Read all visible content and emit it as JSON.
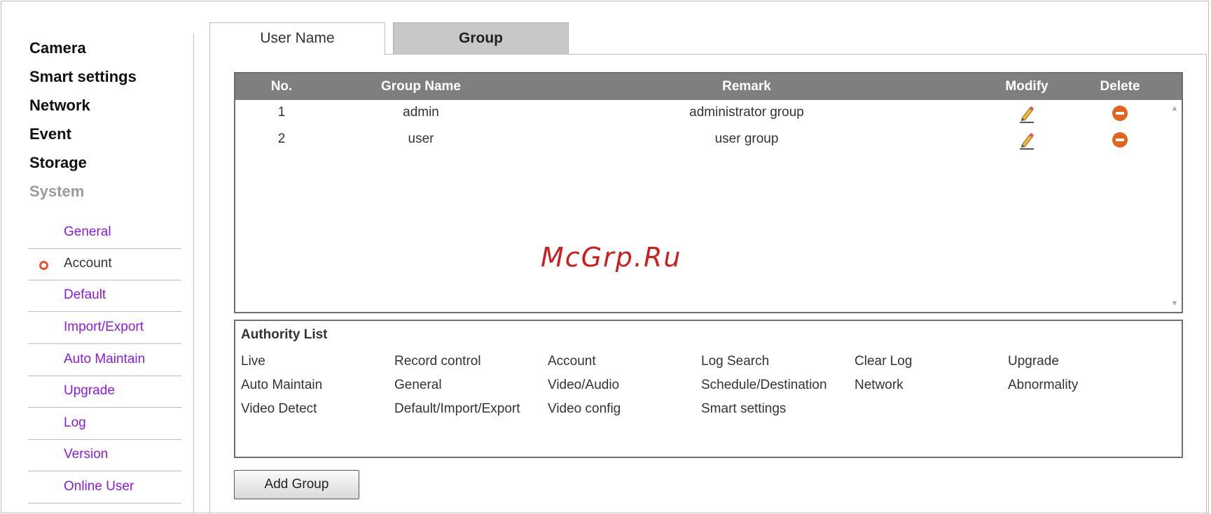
{
  "sidebar": {
    "top_items": [
      "Camera",
      "Smart settings",
      "Network",
      "Event",
      "Storage",
      "System"
    ],
    "sub_items": [
      "General",
      "Account",
      "Default",
      "Import/Export",
      "Auto Maintain",
      "Upgrade",
      "Log",
      "Version",
      "Online User"
    ],
    "active_sub_item": "Account"
  },
  "tabs": {
    "user_name": "User Name",
    "group": "Group",
    "active": "Group"
  },
  "group_table": {
    "headers": {
      "no": "No.",
      "group_name": "Group Name",
      "remark": "Remark",
      "modify": "Modify",
      "delete": "Delete"
    },
    "rows": [
      {
        "no": "1",
        "group_name": "admin",
        "remark": "administrator group",
        "modify_icon": "pencil-icon",
        "delete_icon": "minus-circle-icon"
      },
      {
        "no": "2",
        "group_name": "user",
        "remark": "user group",
        "modify_icon": "pencil-icon",
        "delete_icon": "minus-circle-icon"
      }
    ]
  },
  "authority": {
    "title": "Authority List",
    "items": [
      [
        "Live",
        "Record control",
        "Account",
        "Log Search",
        "Clear Log",
        "Upgrade"
      ],
      [
        "Auto Maintain",
        "General",
        "Video/Audio",
        "Schedule/Destination",
        "Network",
        "Abnormality"
      ],
      [
        "Video Detect",
        "Default/Import/Export",
        "Video config",
        "Smart settings"
      ]
    ]
  },
  "watermark": "McGrp.Ru",
  "buttons": {
    "add_group": "Add Group"
  },
  "colors": {
    "submenu_link": "#8a1be0",
    "table_header": "#7f7f7f",
    "active_tab": "#c8c8c8",
    "delete_icon": "#e2641f",
    "active_bullet": "#e3552d",
    "watermark": "#cc1f1f"
  }
}
